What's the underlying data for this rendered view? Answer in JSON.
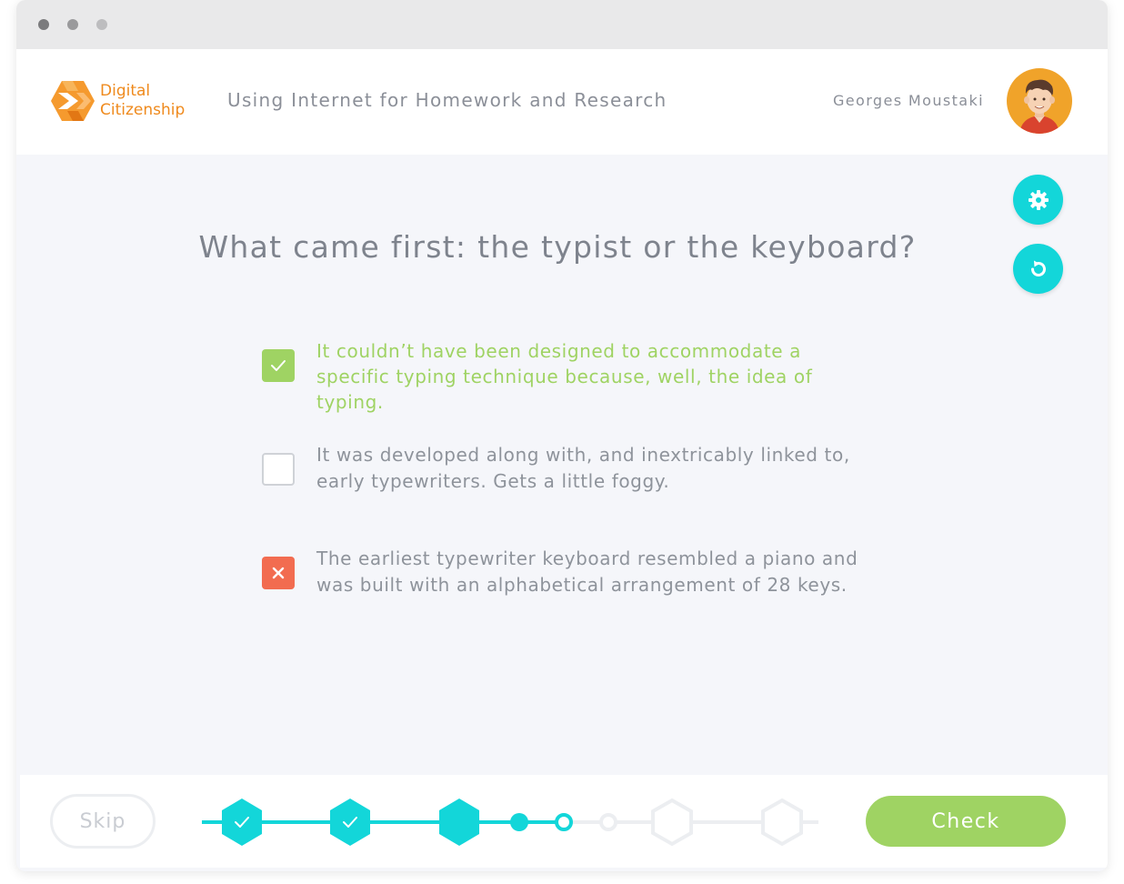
{
  "window": {
    "controls": [
      "close-dot",
      "minimize-dot",
      "maximize-dot"
    ]
  },
  "header": {
    "brand_line1": "Digital",
    "brand_line2": "Citizenship",
    "course_title": "Using Internet for Homework and Research",
    "user_name": "Georges Moustaki",
    "brand_color": "#ef8a1d"
  },
  "side_actions": {
    "settings_icon": "gear-icon",
    "reset_icon": "refresh-icon",
    "accent": "#13d6d9"
  },
  "quiz": {
    "question": "What came first: the typist or the keyboard?",
    "options": [
      {
        "text": "It couldn’t have been designed to accommodate a specific typing technique because, well, the idea of typing.",
        "state": "correct",
        "icon": "check-icon"
      },
      {
        "text": "It was developed along with, and inextricably linked to, early typewriters. Gets a little foggy.",
        "state": "unselected",
        "icon": ""
      },
      {
        "text": "The earliest typewriter keyboard resembled a piano and was built with an alphabetical arrangement of 28 keys.",
        "state": "incorrect",
        "icon": "close-icon"
      }
    ],
    "correct_color": "#9fd363",
    "incorrect_color": "#f26c50"
  },
  "footer": {
    "skip_label": "Skip",
    "check_label": "Check",
    "progress_steps": [
      {
        "kind": "hexagon",
        "status": "done"
      },
      {
        "kind": "hexagon",
        "status": "done"
      },
      {
        "kind": "hexagon",
        "status": "active"
      },
      {
        "kind": "dot",
        "status": "done"
      },
      {
        "kind": "dot",
        "status": "current"
      },
      {
        "kind": "dot",
        "status": "todo"
      },
      {
        "kind": "hexagon",
        "status": "todo"
      },
      {
        "kind": "hexagon",
        "status": "todo"
      }
    ]
  }
}
